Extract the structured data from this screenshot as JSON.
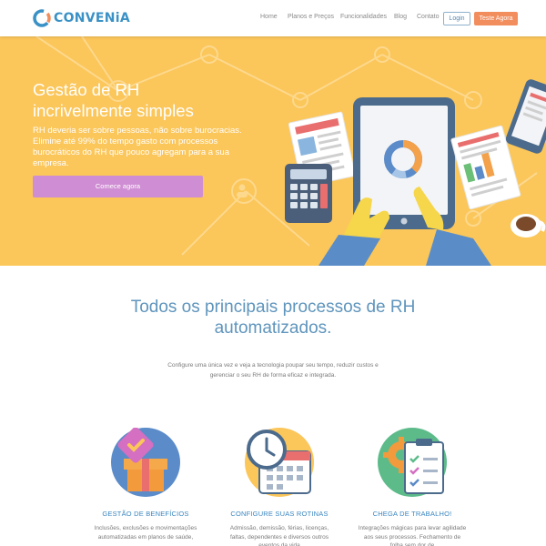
{
  "nav": {
    "brand": "CONVENiA",
    "links": [
      "Home",
      "Planos e Preços",
      "Funcionalidades",
      "Blog",
      "Contato"
    ],
    "login": "Login",
    "trial": "Teste Agora"
  },
  "hero": {
    "title_line1": "Gestão de RH",
    "title_line2": "incrivelmente simples",
    "subtitle": "RH deveria ser sobre pessoas, não sobre burocracias. Elimine até 99% do tempo gasto com processos burocráticos do RH que pouco agregam para a sua empresa.",
    "cta": "Comece agora"
  },
  "section": {
    "title_line1": "Todos os principais processos de RH",
    "title_line2": "automatizados.",
    "description": "Configure uma única vez e veja a tecnologia poupar seu tempo, reduzir custos e gerenciar o seu RH de forma eficaz e integrada."
  },
  "features": [
    {
      "icon": "gift-icon",
      "title": "GESTÃO DE BENEFÍCIOS",
      "text": "Inclusões, exclusões e movimentações automatizadas em planos de saúde,"
    },
    {
      "icon": "clock-calendar-icon",
      "title": "CONFIGURE SUAS ROTINAS",
      "text": "Admissão, demissão, férias, licenças, faltas, dependentes e diversos outros eventos da vida"
    },
    {
      "icon": "gear-checklist-icon",
      "title": "CHEGA DE TRABALHO!",
      "text": "Integrações mágicas para levar agilidade aos seus processos. Fechamento de folha sem dor de"
    }
  ],
  "colors": {
    "brand_blue": "#3a91c6",
    "hero_yellow": "#fbc65a",
    "cta_purple": "#cf8ed3",
    "trial_orange": "#f28e5e"
  }
}
